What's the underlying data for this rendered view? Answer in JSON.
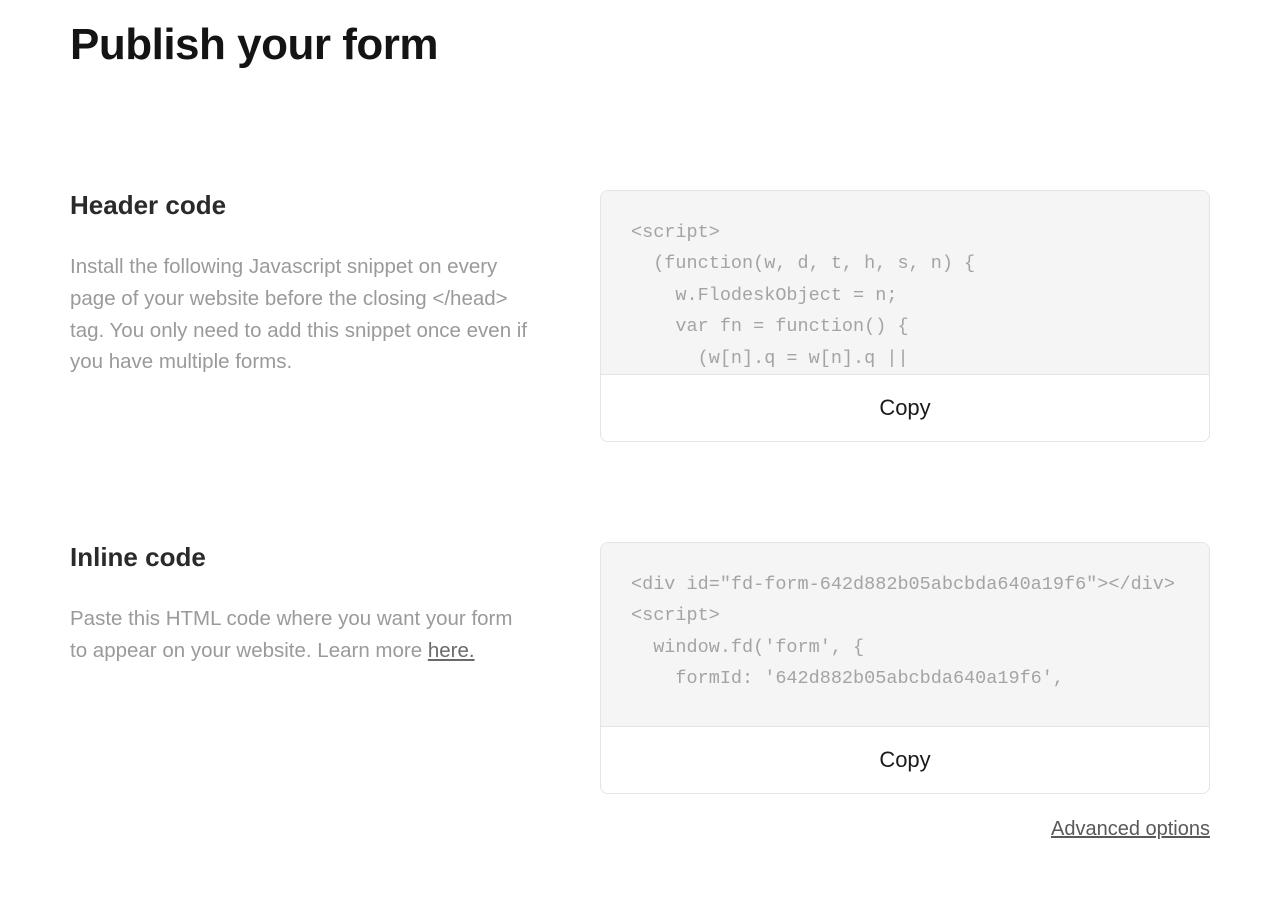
{
  "title": "Publish your form",
  "sections": [
    {
      "heading": "Header code",
      "desc_prefix": "Install the following Javascript snippet on every page of your website before the closing </head> tag. You only need to add this snippet once even if you have multiple forms.",
      "link_text": "",
      "code": "<script>\n  (function(w, d, t, h, s, n) {\n    w.FlodeskObject = n;\n    var fn = function() {\n      (w[n].q = w[n].q ||",
      "copy_label": "Copy"
    },
    {
      "heading": "Inline code",
      "desc_prefix": "Paste this HTML code where you want your form to appear on your website. Learn more ",
      "link_text": "here.",
      "code": "<div id=\"fd-form-642d882b05abcbda640a19f6\"></div>\n<script>\n  window.fd('form', {\n    formId: '642d882b05abcbda640a19f6',",
      "copy_label": "Copy"
    }
  ],
  "advanced_label": "Advanced options"
}
